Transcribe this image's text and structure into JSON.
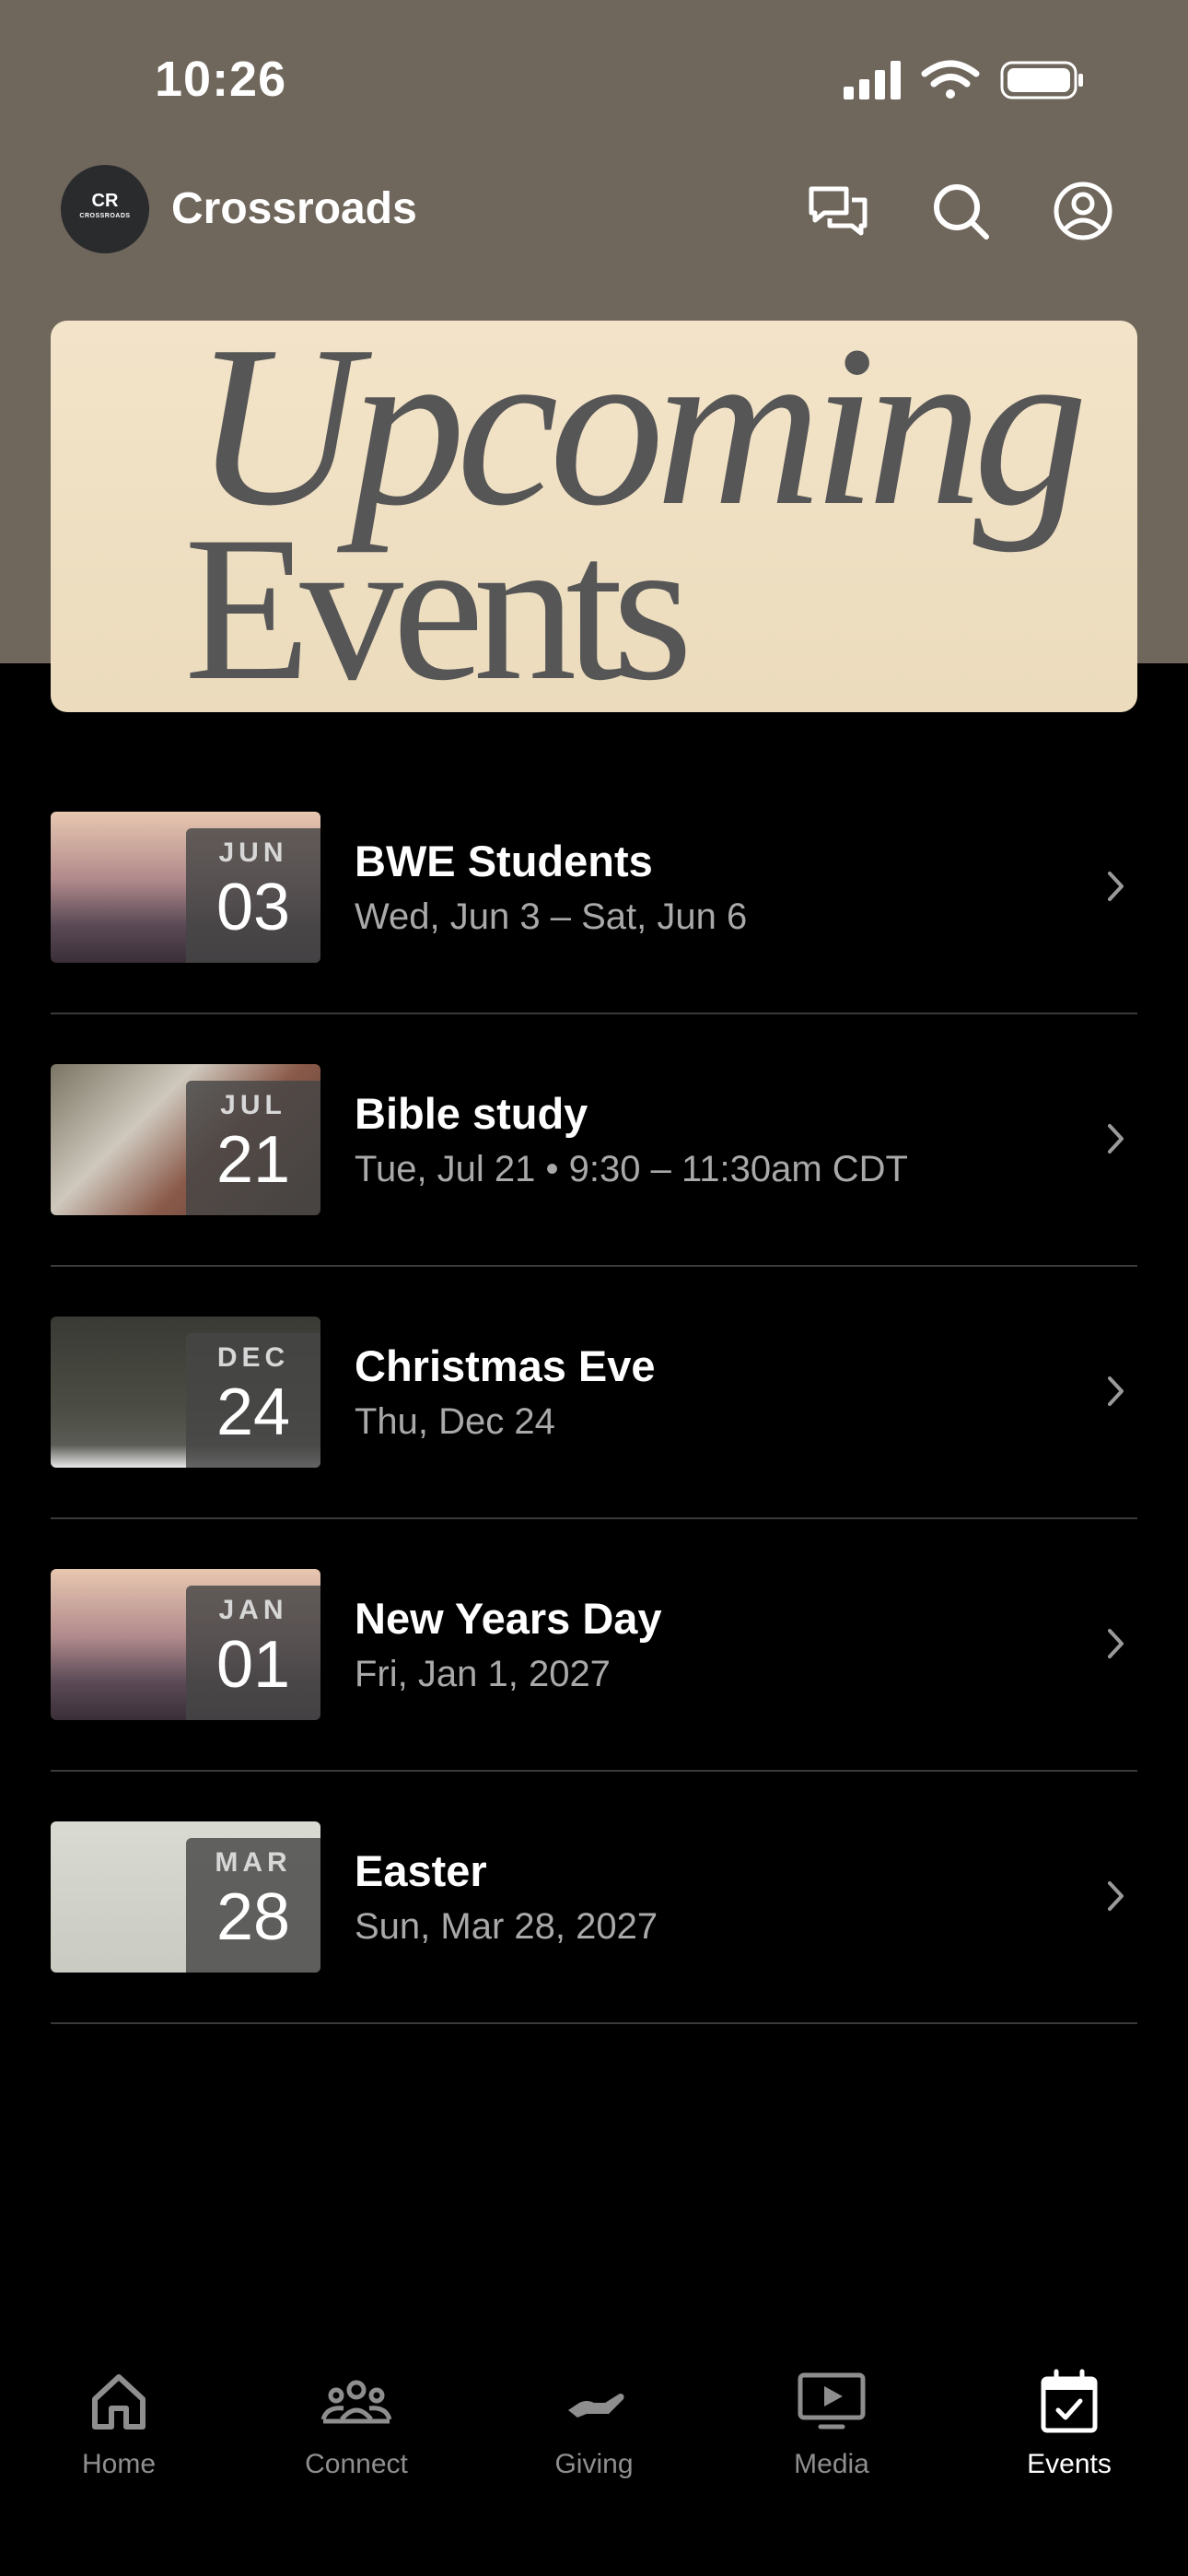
{
  "status_bar": {
    "time": "10:26"
  },
  "header": {
    "logo_text": "CR",
    "logo_subtext": "CROSSROADS",
    "brand": "Crossroads",
    "icons": [
      "chat-icon",
      "search-icon",
      "profile-icon"
    ]
  },
  "banner": {
    "line1": "Upcoming",
    "line2": "Events"
  },
  "events": [
    {
      "month": "JUN",
      "day": "03",
      "title": "BWE Students",
      "subtitle": "Wed, Jun 3 – Sat, Jun 6"
    },
    {
      "month": "JUL",
      "day": "21",
      "title": "Bible study",
      "subtitle": "Tue, Jul 21 • 9:30 – 11:30am CDT"
    },
    {
      "month": "DEC",
      "day": "24",
      "title": "Christmas Eve",
      "subtitle": "Thu, Dec 24"
    },
    {
      "month": "JAN",
      "day": "01",
      "title": "New Years Day",
      "subtitle": "Fri, Jan 1, 2027"
    },
    {
      "month": "MAR",
      "day": "28",
      "title": "Easter",
      "subtitle": "Sun, Mar 28, 2027"
    }
  ],
  "tabs": [
    {
      "label": "Home",
      "icon": "home-icon",
      "active": false
    },
    {
      "label": "Connect",
      "icon": "people-icon",
      "active": false
    },
    {
      "label": "Giving",
      "icon": "giving-icon",
      "active": false
    },
    {
      "label": "Media",
      "icon": "media-icon",
      "active": false
    },
    {
      "label": "Events",
      "icon": "calendar-icon",
      "active": true
    }
  ],
  "colors": {
    "header_bg": "#6f665c",
    "banner_bg": "#f3e3c8",
    "page_bg": "#000000"
  }
}
